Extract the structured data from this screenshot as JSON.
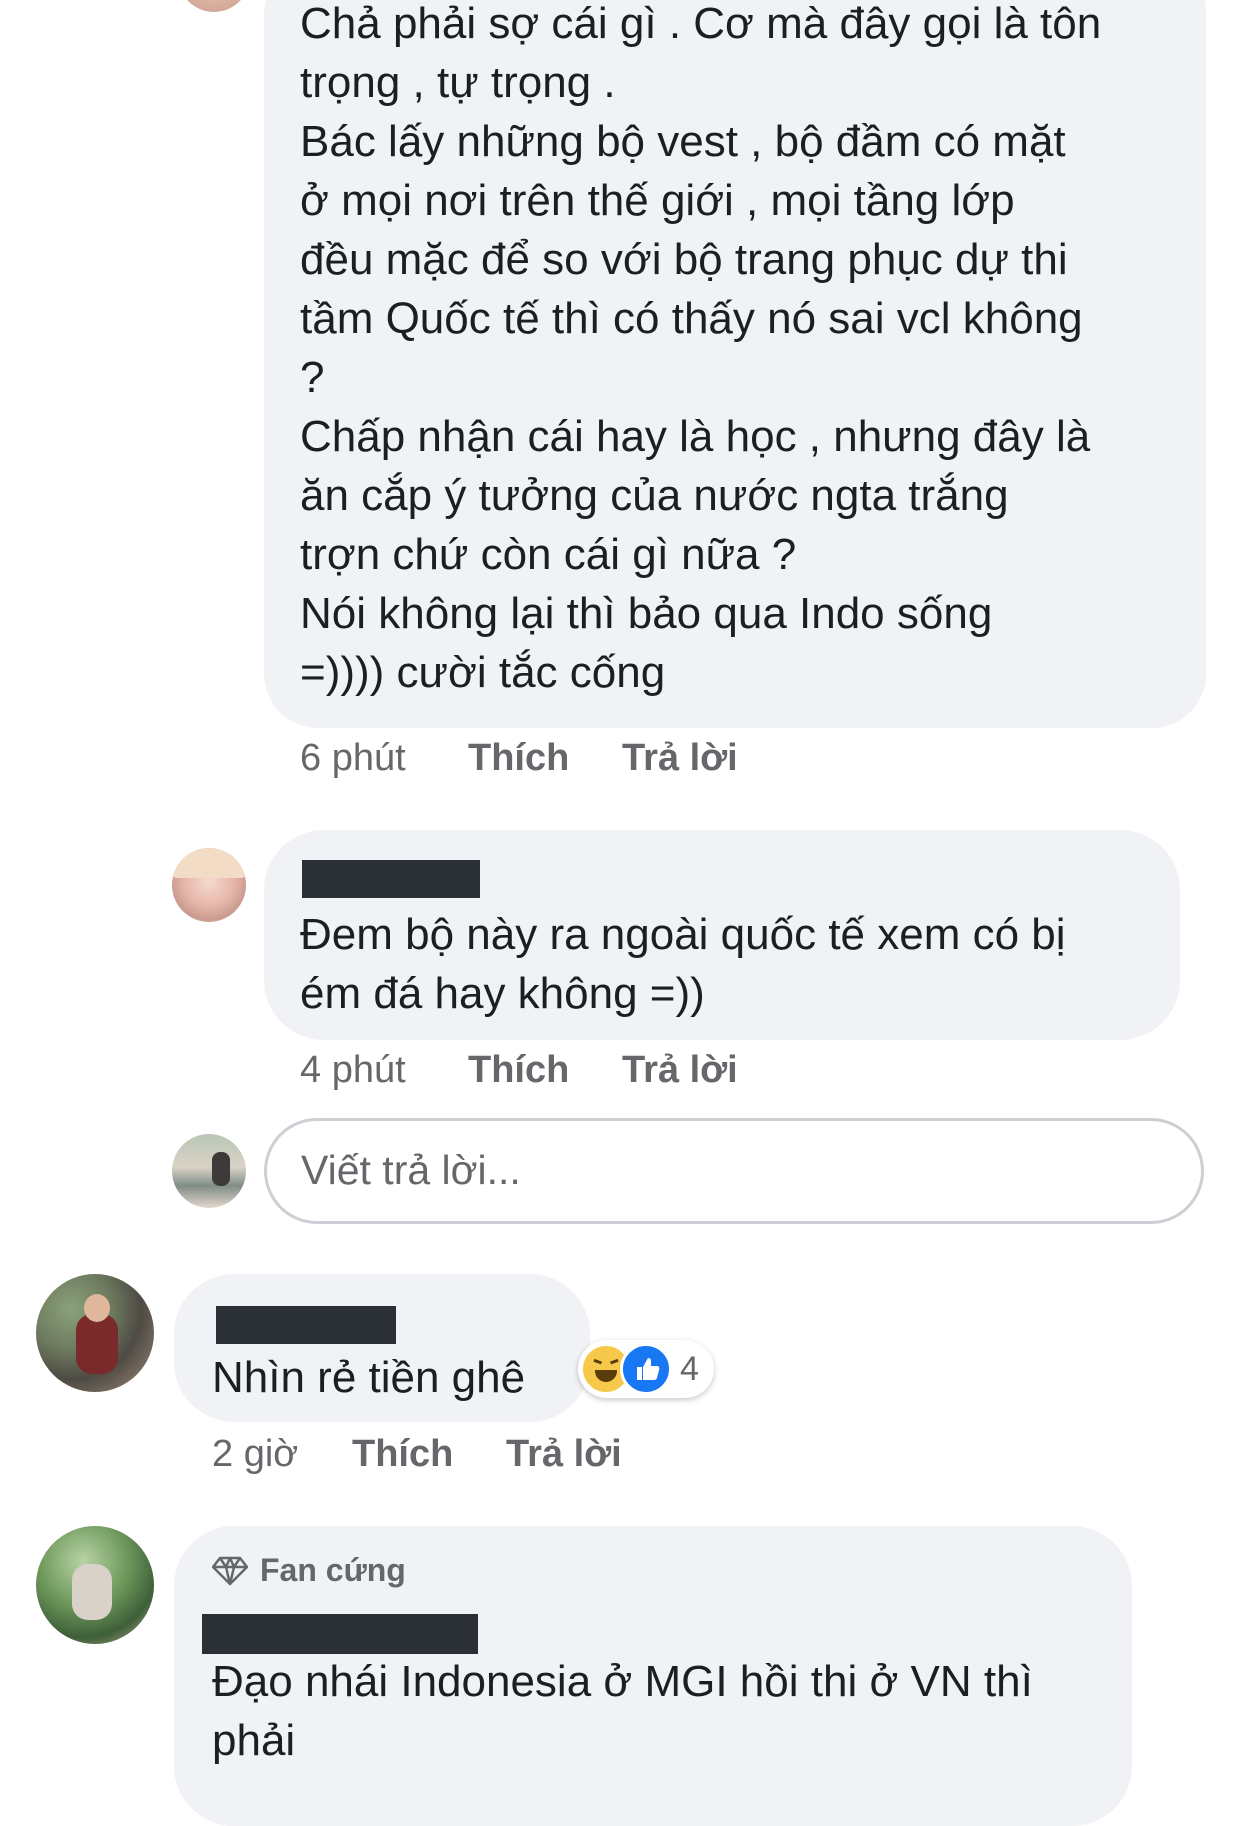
{
  "comments": [
    {
      "text": "Chả phải sợ cái gì . Cơ mà đây gọi là tôn\ntrọng , tự trọng .\nBác lấy những bộ vest , bộ đầm có mặt\nở mọi nơi trên thế giới , mọi tầng lớp\nđều mặc để so với bộ trang phục dự thi\ntầm Quốc tế thì có thấy nó sai vcl không\n?\nChấp nhận cái hay là học , nhưng đây là\năn cắp ý tưởng của nước ngta trắng\ntrợn chứ còn cái gì nữa ?\nNói không lại thì bảo qua Indo sống\n=)))) cười tắc cống",
      "time": "6 phút",
      "like": "Thích",
      "reply": "Trả lời"
    },
    {
      "text": "Đem bộ này ra ngoài quốc tế xem có bị\ném đá hay không =))",
      "time": "4 phút",
      "like": "Thích",
      "reply": "Trả lời"
    },
    {
      "text": "Nhìn rẻ tiền ghê",
      "time": "2 giờ",
      "like": "Thích",
      "reply": "Trả lời",
      "reaction_count": "4"
    },
    {
      "badge": "Fan cứng",
      "text": "Đạo nhái Indonesia ở MGI hồi thi ở VN thì\nphải"
    }
  ],
  "reply_input": {
    "placeholder": "Viết trả lời..."
  },
  "colors": {
    "bubble": "#f0f2f5",
    "secondary_text": "#65676b",
    "like_blue": "#1877f2",
    "haha_yellow": "#f7c94b",
    "redaction": "#2b3037"
  },
  "icons": [
    "haha-reaction-icon",
    "like-reaction-icon",
    "diamond-icon"
  ]
}
